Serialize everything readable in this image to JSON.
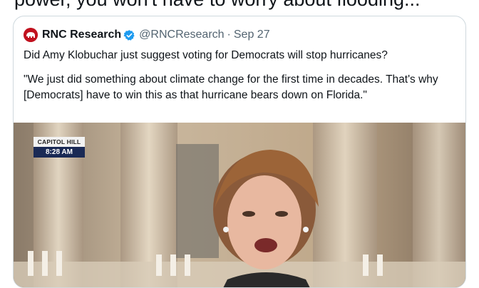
{
  "tweet": {
    "text_fragment": "power, you won't have to worry about flooding..."
  },
  "quoted_tweet": {
    "author_name": "RNC Research",
    "verified_icon": "verified-badge-icon",
    "handle": "@RNCResearch",
    "separator": "·",
    "date": "Sep 27",
    "text_line1": "Did Amy Klobuchar just suggest voting for Democrats will stop hurricanes?",
    "text_line2": "\"We just did something about climate change for the first time in decades. That's why [Democrats] have to win this as that hurricane bears down on Florida.\"",
    "media": {
      "type": "video-thumbnail",
      "overlay_location": "CAPITOL HILL",
      "overlay_time": "8:28 AM"
    }
  },
  "colors": {
    "text_primary": "#0f1419",
    "text_secondary": "#536471",
    "verified_blue": "#1d9bf0",
    "card_border": "#cfd9de",
    "avatar_red": "#c1121f",
    "lower_third_blue": "#1a2a55"
  }
}
